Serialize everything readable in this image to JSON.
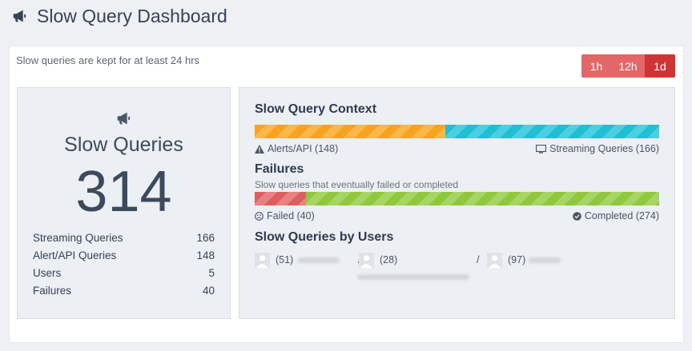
{
  "header": {
    "title": "Slow Query Dashboard",
    "icon": "megaphone-icon"
  },
  "notice": "Slow queries are kept for at least 24 hrs",
  "time_range": {
    "options": [
      "1h",
      "12h",
      "1d"
    ],
    "selected": "1d"
  },
  "summary": {
    "title": "Slow Queries",
    "count": "314",
    "stats": [
      {
        "label": "Streaming Queries",
        "value": "166"
      },
      {
        "label": "Alert/API Queries",
        "value": "148"
      },
      {
        "label": "Users",
        "value": "5"
      },
      {
        "label": "Failures",
        "value": "40"
      }
    ]
  },
  "context": {
    "title": "Slow Query Context",
    "alerts_label": "Alerts/API (148)",
    "streaming_label": "Streaming Queries (166)",
    "alerts_fraction": 0.4713,
    "streaming_fraction": 0.5287
  },
  "failures": {
    "title": "Failures",
    "subtitle": "Slow queries that eventually failed or completed",
    "failed_label": "Failed (40)",
    "completed_label": "Completed (274)",
    "failed_fraction": 0.1274,
    "completed_fraction": 0.8726
  },
  "users": {
    "title": "Slow Queries by Users",
    "entries": [
      {
        "count": "(51)"
      },
      {
        "count": "(28)"
      },
      {
        "count": "(97)"
      }
    ],
    "separator": "/"
  },
  "colors": {
    "alerts": "#f6a41f",
    "streaming": "#20bfd3",
    "failed": "#dc5f5f",
    "completed": "#8fc73d",
    "range_active": "#cf3434",
    "range_inactive": "#e36767"
  }
}
